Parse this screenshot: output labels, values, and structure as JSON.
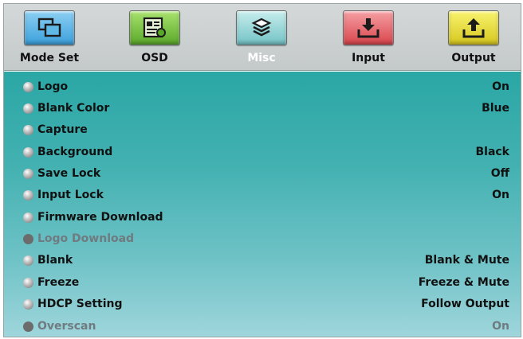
{
  "tabs": [
    {
      "label": "Mode Set",
      "icon": "windows-icon"
    },
    {
      "label": "OSD",
      "icon": "osd-document-icon"
    },
    {
      "label": "Misc",
      "icon": "stack-icon"
    },
    {
      "label": "Input",
      "icon": "input-tray-icon"
    },
    {
      "label": "Output",
      "icon": "output-tray-icon"
    }
  ],
  "active_tab": "Misc",
  "menu": [
    {
      "label": "Logo",
      "value": "On",
      "enabled": true
    },
    {
      "label": "Blank Color",
      "value": "Blue",
      "enabled": true
    },
    {
      "label": "Capture",
      "value": "",
      "enabled": true
    },
    {
      "label": "Background",
      "value": "Black",
      "enabled": true
    },
    {
      "label": "Save Lock",
      "value": "Off",
      "enabled": true
    },
    {
      "label": "Input Lock",
      "value": "On",
      "enabled": true
    },
    {
      "label": "Firmware Download",
      "value": "",
      "enabled": true
    },
    {
      "label": "Logo Download",
      "value": "",
      "enabled": false
    },
    {
      "label": "Blank",
      "value": "Blank & Mute",
      "enabled": true
    },
    {
      "label": "Freeze",
      "value": "Freeze & Mute",
      "enabled": true
    },
    {
      "label": "HDCP Setting",
      "value": "Follow Output",
      "enabled": true
    },
    {
      "label": "Overscan",
      "value": "On",
      "enabled": false
    }
  ],
  "colors": {
    "menu_gradient_top": "#2aa7a5",
    "menu_gradient_bottom": "#9fd6dc",
    "disabled_text": "#6f7b80",
    "active_tab_label": "#ffffff"
  }
}
